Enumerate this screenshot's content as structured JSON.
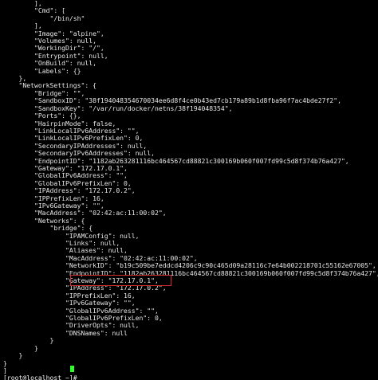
{
  "terminal": {
    "lines": [
      "        ],",
      "        \"Cmd\": [",
      "            \"/bin/sh\"",
      "        ],",
      "        \"Image\": \"alpine\",",
      "        \"Volumes\": null,",
      "        \"WorkingDir\": \"/\",",
      "        \"Entrypoint\": null,",
      "        \"OnBuild\": null,",
      "        \"Labels\": {}",
      "    },",
      "    \"NetworkSettings\": {",
      "        \"Bridge\": \"\",",
      "        \"SandboxID\": \"38f194048354670034ee6d8f4ce0b43ed7cb179a89b1d8fba96f7ac4bde27f2\",",
      "        \"SandboxKey\": \"/var/run/docker/netns/38f194048354\",",
      "        \"Ports\": {},",
      "        \"HairpinMode\": false,",
      "        \"LinkLocalIPv6Address\": \"\",",
      "        \"LinkLocalIPv6PrefixLen\": 0,",
      "        \"SecondaryIPAddresses\": null,",
      "        \"SecondaryIPv6Addresses\": null,",
      "        \"EndpointID\": \"1182ab263281116bc464567cd88821c300169b060f007fd99c5d8f374b76a427\",",
      "        \"Gateway\": \"172.17.0.1\",",
      "        \"GlobalIPv6Address\": \"\",",
      "        \"GlobalIPv6PrefixLen\": 0,",
      "        \"IPAddress\": \"172.17.0.2\",",
      "        \"IPPrefixLen\": 16,",
      "        \"IPv6Gateway\": \"\",",
      "        \"MacAddress\": \"02:42:ac:11:00:02\",",
      "        \"Networks\": {",
      "            \"bridge\": {",
      "                \"IPAMConfig\": null,",
      "                \"Links\": null,",
      "                \"Aliases\": null,",
      "                \"MacAddress\": \"02:42:ac:11:00:02\",",
      "                \"NetworkID\": \"b19c509be7eddcd4206c9c90c465d09a28116c7e64b002218701c55162e67005\",",
      "                \"EndpointID\": \"1182ab263281116bc464567cd88821c300169b060f007fd99c5d8f374b76a427\",",
      "                \"Gateway\": \"172.17.0.1\",",
      "                \"IPAddress\": \"172.17.0.2\",",
      "                \"IPPrefixLen\": 16,",
      "                \"IPv6Gateway\": \"\",",
      "                \"GlobalIPv6Address\": \"\",",
      "                \"GlobalIPv6PrefixLen\": 0,",
      "                \"DriverOpts\": null,",
      "                \"DNSNames\": null",
      "            }",
      "        }",
      "    }",
      "}",
      "]",
      "[root@localhost ~]# "
    ],
    "highlighted_text": "\"IPAddress\": \"172.17.0.2\",",
    "colors": {
      "background": "#000000",
      "text": "#e8e8e8",
      "highlight_border": "#d42a2a",
      "cursor": "#2cff2c"
    }
  }
}
